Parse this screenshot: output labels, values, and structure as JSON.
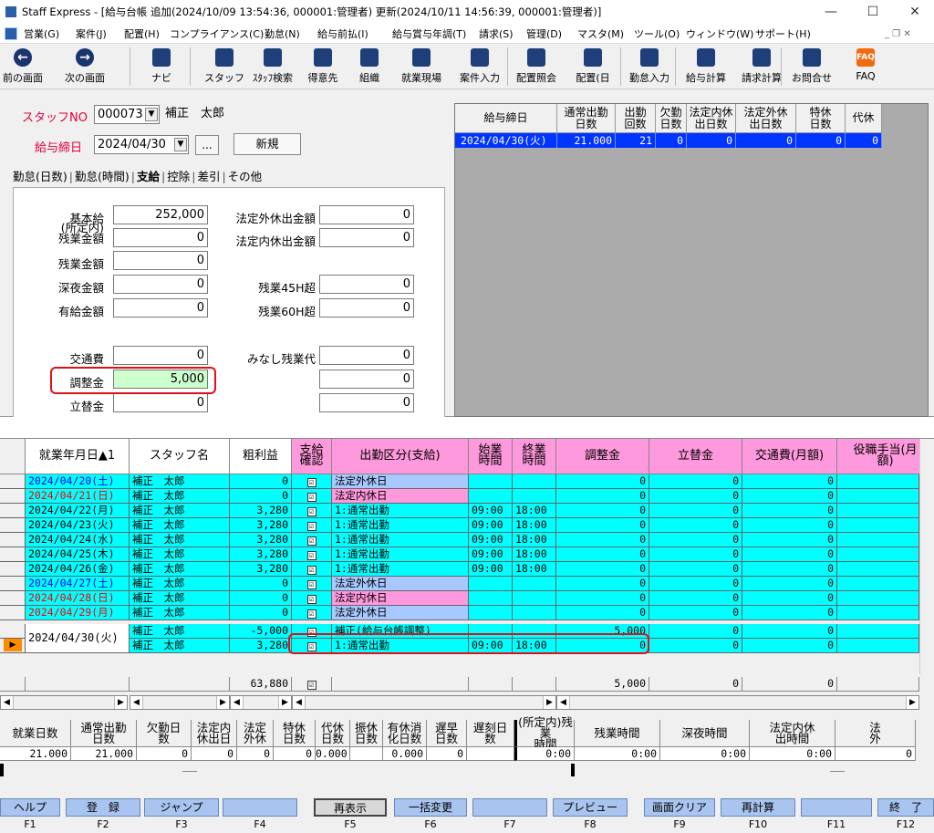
{
  "window": {
    "title": "Staff Express - [給与台帳 追加(2024/10/09 13:54:36, 000001:管理者) 更新(2024/10/11 14:56:39, 000001:管理者)]",
    "minimize": "—",
    "maximize": "☐",
    "close": "✕"
  },
  "menu": [
    "営業(G)",
    "案件(J)",
    "配置(H)",
    "コンプライアンス(C)",
    "勤怠(N)",
    "給与前払(I)",
    "給与賞与年調(T)",
    "請求(S)",
    "管理(D)",
    "マスタ(M)",
    "ツール(O)",
    "ウィンドウ(W)",
    "サポート(H)"
  ],
  "menu_controls": "_ ❐ ✕",
  "toolbar": [
    {
      "label": "前の画面",
      "icon": "back-arrow-icon"
    },
    {
      "label": "次の画面",
      "icon": "forward-arrow-icon"
    },
    {
      "label": "ナビ",
      "icon": "navi-icon"
    },
    {
      "label": "スタッフ",
      "icon": "staff-icon"
    },
    {
      "label": "ｽﾀｯﾌ検索",
      "icon": "staff-search-icon"
    },
    {
      "label": "得意先",
      "icon": "client-icon"
    },
    {
      "label": "組織",
      "icon": "org-icon"
    },
    {
      "label": "就業現場",
      "icon": "worksite-icon"
    },
    {
      "label": "案件入力",
      "icon": "case-input-icon"
    },
    {
      "label": "配置照会",
      "icon": "placement-inquiry-icon"
    },
    {
      "label": "配置(日",
      "icon": "placement-day-icon"
    },
    {
      "label": "勤怠入力",
      "icon": "attendance-input-icon"
    },
    {
      "label": "給与計算",
      "icon": "payroll-calc-icon"
    },
    {
      "label": "請求計算",
      "icon": "billing-calc-icon"
    },
    {
      "label": "お問合せ",
      "icon": "inquiry-icon"
    },
    {
      "label": "FAQ",
      "icon": "faq-icon"
    }
  ],
  "form": {
    "staff_no_label": "スタッフNO",
    "staff_no": "000073",
    "staff_name": "補正　太郎",
    "pay_close_label": "給与締日",
    "pay_close": "2024/04/30",
    "ellipsis": "...",
    "new_button": "新規"
  },
  "tabs": [
    "勤怠(日数)",
    "勤怠(時間)",
    "支給",
    "控除",
    "差引",
    "その他"
  ],
  "pay": {
    "basic_label": "基本給",
    "basic": "252,000",
    "in_ot_label1": "(所定内)",
    "in_ot_label2": "残業金額",
    "in_ot": "0",
    "ot_label": "残業金額",
    "ot": "0",
    "night_label": "深夜金額",
    "night": "0",
    "paid_label": "有給金額",
    "paid": "0",
    "transport_label": "交通費",
    "transport": "0",
    "adjust_label": "調整金",
    "adjust": "5,000",
    "advance_label": "立替金",
    "advance": "0",
    "legal_out_label": "法定外休出金額",
    "legal_out": "0",
    "legal_in_label": "法定内休出金額",
    "legal_in": "0",
    "ot45_label": "残業45H超",
    "ot45": "0",
    "ot60_label": "残業60H超",
    "ot60": "0",
    "deemed_label": "みなし残業代",
    "deemed": "0",
    "extra1": "0",
    "extra2": "0"
  },
  "topgrid": {
    "headers": [
      "給与締日",
      "通常出勤\n日数",
      "出勤\n回数",
      "欠勤\n日数",
      "法定内休\n出日数",
      "法定外休\n出日数",
      "特休\n日数",
      "代休"
    ],
    "row": [
      "2024/04/30(火)",
      "21.000",
      "21",
      "0",
      "0",
      "0",
      "0",
      "0"
    ]
  },
  "grid": {
    "headers": [
      "就業年月日▲1",
      "スタッフ名",
      "粗利益",
      "支給\n確認",
      "出勤区分(支給)",
      "始業\n時間",
      "終業\n時間",
      "調整金",
      "立替金",
      "交通費(月額)",
      "役職手当(月\n額)"
    ],
    "rows": [
      {
        "date": "2024/04/20(土)",
        "color": "blue",
        "name": "補正　太郎",
        "profit": "0",
        "kubun": "法定外休日",
        "kc": "#a8c8ff",
        "start": "",
        "end": "",
        "adjust": "0",
        "advance": "0",
        "trans": "0"
      },
      {
        "date": "2024/04/21(日)",
        "color": "red",
        "name": "補正　太郎",
        "profit": "0",
        "kubun": "法定内休日",
        "kc": "#ff99dd",
        "start": "",
        "end": "",
        "adjust": "0",
        "advance": "0",
        "trans": "0"
      },
      {
        "date": "2024/04/22(月)",
        "color": "black",
        "name": "補正　太郎",
        "profit": "3,280",
        "kubun": "1:通常出勤",
        "kc": "",
        "start": "09:00",
        "end": "18:00",
        "adjust": "0",
        "advance": "0",
        "trans": "0"
      },
      {
        "date": "2024/04/23(火)",
        "color": "black",
        "name": "補正　太郎",
        "profit": "3,280",
        "kubun": "1:通常出勤",
        "kc": "",
        "start": "09:00",
        "end": "18:00",
        "adjust": "0",
        "advance": "0",
        "trans": "0"
      },
      {
        "date": "2024/04/24(水)",
        "color": "black",
        "name": "補正　太郎",
        "profit": "3,280",
        "kubun": "1:通常出勤",
        "kc": "",
        "start": "09:00",
        "end": "18:00",
        "adjust": "0",
        "advance": "0",
        "trans": "0"
      },
      {
        "date": "2024/04/25(木)",
        "color": "black",
        "name": "補正　太郎",
        "profit": "3,280",
        "kubun": "1:通常出勤",
        "kc": "",
        "start": "09:00",
        "end": "18:00",
        "adjust": "0",
        "advance": "0",
        "trans": "0"
      },
      {
        "date": "2024/04/26(金)",
        "color": "black",
        "name": "補正　太郎",
        "profit": "3,280",
        "kubun": "1:通常出勤",
        "kc": "",
        "start": "09:00",
        "end": "18:00",
        "adjust": "0",
        "advance": "0",
        "trans": "0"
      },
      {
        "date": "2024/04/27(土)",
        "color": "blue",
        "name": "補正　太郎",
        "profit": "0",
        "kubun": "法定外休日",
        "kc": "#a8c8ff",
        "start": "",
        "end": "",
        "adjust": "0",
        "advance": "0",
        "trans": "0"
      },
      {
        "date": "2024/04/28(日)",
        "color": "red",
        "name": "補正　太郎",
        "profit": "0",
        "kubun": "法定内休日",
        "kc": "#ff99dd",
        "start": "",
        "end": "",
        "adjust": "0",
        "advance": "0",
        "trans": "0"
      },
      {
        "date": "2024/04/29(月)",
        "color": "red",
        "name": "補正　太郎",
        "profit": "0",
        "kubun": "法定外休日",
        "kc": "#a8c8ff",
        "start": "",
        "end": "",
        "adjust": "0",
        "advance": "0",
        "trans": "0"
      },
      {
        "date": "2024/04/30(火)",
        "color": "black",
        "name": "補正　太郎",
        "profit": "-5,000",
        "kubun": "補正(給与台帳調整)",
        "kc": "",
        "start": "",
        "end": "",
        "adjust": "5,000",
        "advance": "0",
        "trans": "0"
      },
      {
        "date": "",
        "color": "black",
        "name": "補正　太郎",
        "profit": "3,280",
        "kubun": "1:通常出勤",
        "kc": "",
        "start": "09:00",
        "end": "18:00",
        "adjust": "0",
        "advance": "0",
        "trans": "0"
      }
    ],
    "sum": {
      "profit": "63,880",
      "adjust": "5,000",
      "advance": "0",
      "trans": "0"
    }
  },
  "summary": {
    "headers": [
      "就業日数",
      "通常出勤\n日数",
      "欠勤日\n数",
      "法定内\n休出日",
      "法定\n外休",
      "特休\n日数",
      "代休\n日数",
      "振休\n日数",
      "有休消\n化日数",
      "遅早\n日数",
      "遅刻日\n数",
      "(所定内)残業\n時間",
      "残業時間",
      "深夜時間",
      "法定内休\n出時間",
      "法\n外"
    ],
    "values": [
      "21.000",
      "21.000",
      "0",
      "0",
      "0",
      "0",
      "0.000",
      "",
      "0.000",
      "0",
      "",
      "0:00",
      "0:00",
      "0:00",
      "0:00",
      "0"
    ]
  },
  "fkeys": [
    {
      "label": "ヘルプ",
      "key": "F1"
    },
    {
      "label": "登　録",
      "key": "F2"
    },
    {
      "label": "ジャンプ",
      "key": "F3"
    },
    {
      "label": "",
      "key": "F4"
    },
    {
      "label": "再表示",
      "key": "F5"
    },
    {
      "label": "一括変更",
      "key": "F6"
    },
    {
      "label": "",
      "key": "F7"
    },
    {
      "label": "プレビュー",
      "key": "F8"
    },
    {
      "label": "画面クリア",
      "key": "F9"
    },
    {
      "label": "再計算",
      "key": "F10"
    },
    {
      "label": "",
      "key": "F11"
    },
    {
      "label": "終　了",
      "key": "F12"
    }
  ],
  "colors": {
    "cyan": "#00ffff",
    "pink": "#ff99dd",
    "highlight": "#e0101a",
    "select": "#0034ff"
  }
}
